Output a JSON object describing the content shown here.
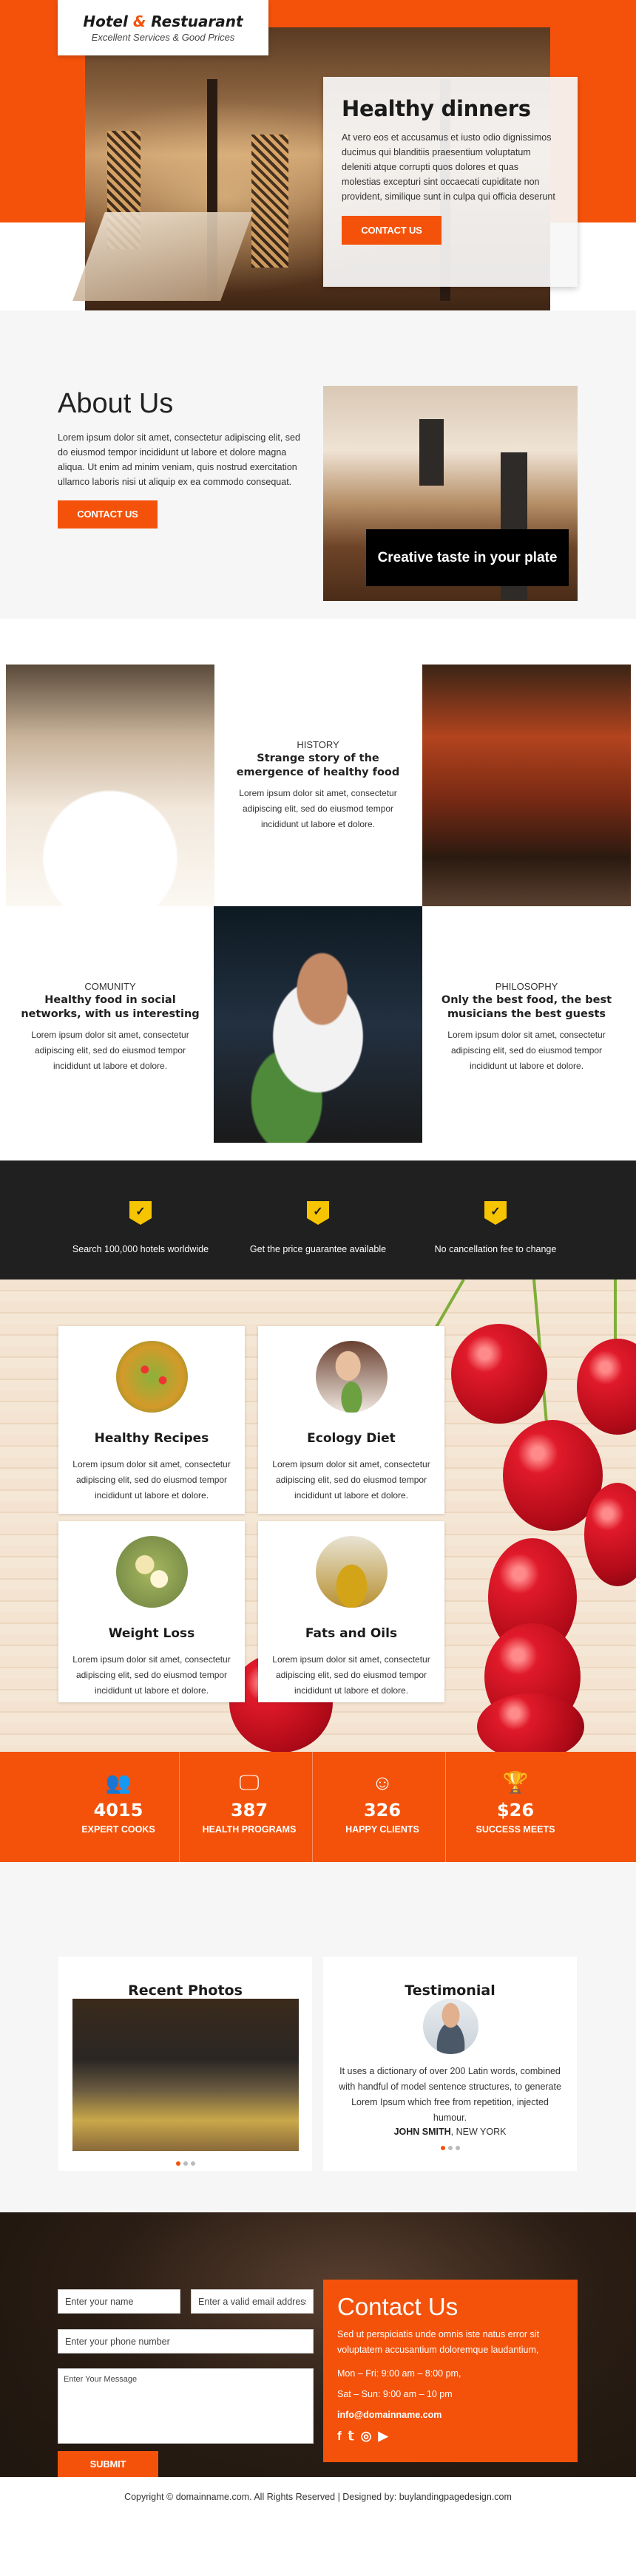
{
  "brand": {
    "name_part1": "Hotel",
    "name_amp": "&",
    "name_part2": "Restuarant",
    "tagline": "Excellent Services & Good Prices",
    "accent_color": "#f4520b"
  },
  "hero": {
    "title": "Healthy dinners",
    "body": "At vero eos et accusamus et iusto odio dignissimos ducimus qui blanditiis praesentium voluptatum deleniti atque corrupti quos dolores et quas molestias excepturi sint occaecati cupiditate non provident, similique sunt in culpa qui officia deserunt",
    "cta": "CONTACT US"
  },
  "about": {
    "title": "About Us",
    "body": "Lorem ipsum dolor sit amet, consectetur adipiscing elit, sed do eiusmod tempor incididunt ut labore et dolore magna aliqua. Ut enim ad minim veniam, quis nostrud exercitation ullamco laboris nisi ut aliquip ex ea commodo consequat.",
    "cta": "CONTACT US",
    "image_caption": "Creative taste in your plate"
  },
  "story_grid": [
    {
      "category": "HISTORY",
      "title": "Strange story of the emergence of healthy food",
      "body": "Lorem ipsum dolor sit amet, consectetur adipiscing elit, sed do eiusmod tempor incididunt ut labore et dolore."
    },
    {
      "category": "COMUNITY",
      "title": "Healthy food in social networks, with us interesting",
      "body": "Lorem ipsum dolor sit amet, consectetur adipiscing elit, sed do eiusmod tempor incididunt ut labore et dolore."
    },
    {
      "category": "PHILOSOPHY",
      "title": "Only the best food, the best musicians the best guests",
      "body": "Lorem ipsum dolor sit amet, consectetur adipiscing elit, sed do eiusmod tempor incididunt ut labore et dolore."
    }
  ],
  "trust": [
    {
      "icon": "shield-check-icon",
      "label": "Search 100,000 hotels worldwide"
    },
    {
      "icon": "shield-check-icon",
      "label": "Get the price guarantee available"
    },
    {
      "icon": "shield-check-icon",
      "label": "No cancellation fee to change"
    }
  ],
  "services": [
    {
      "title": "Healthy Recipes",
      "body": "Lorem ipsum dolor sit amet, consectetur adipiscing elit, sed do eiusmod tempor incididunt ut labore et dolore."
    },
    {
      "title": "Ecology Diet",
      "body": "Lorem ipsum dolor sit amet, consectetur adipiscing elit, sed do eiusmod tempor incididunt ut labore et dolore."
    },
    {
      "title": "Weight Loss",
      "body": "Lorem ipsum dolor sit amet, consectetur adipiscing elit, sed do eiusmod tempor incididunt ut labore et dolore."
    },
    {
      "title": "Fats and Oils",
      "body": "Lorem ipsum dolor sit amet, consectetur adipiscing elit, sed do eiusmod tempor incididunt ut labore et dolore."
    }
  ],
  "stats": [
    {
      "icon": "users-icon",
      "value": "4015",
      "label": "EXPERT COOKS"
    },
    {
      "icon": "monitor-icon",
      "value": "387",
      "label": "HEALTH PROGRAMS"
    },
    {
      "icon": "smiley-icon",
      "value": "326",
      "label": "HAPPY CLIENTS"
    },
    {
      "icon": "trophy-icon",
      "value": "$26",
      "label": "SUCCESS MEETS"
    }
  ],
  "gallery": {
    "photos_title": "Recent Photos",
    "testimonial_title": "Testimonial",
    "quote": "It uses a dictionary of over 200 Latin words, combined with handful of model sentence structures, to generate Lorem Ipsum which free from repetition, injected humour.",
    "author_name": "JOHN SMITH",
    "author_location": ", NEW YORK",
    "photos_active_dot": 1,
    "testimonial_active_dot": 1,
    "dot_count": 3
  },
  "contact_form": {
    "name_placeholder": "Enter your name",
    "email_placeholder": "Enter a valid email address",
    "phone_placeholder": "Enter your phone number",
    "message_placeholder": "Enter Your Message",
    "submit": "SUBMIT"
  },
  "contact_info": {
    "title": "Contact Us",
    "body": "Sed ut perspiciatis unde omnis iste natus error sit voluptatem accusantium doloremque laudantium,",
    "weekday_hours": "Mon – Fri: 9:00 am – 8:00 pm,",
    "weekend_hours": "Sat – Sun: 9:00 am – 10 pm",
    "email": "info@domainname.com",
    "social": [
      {
        "icon": "facebook-icon",
        "glyph": "f"
      },
      {
        "icon": "twitter-icon",
        "glyph": "🐦"
      },
      {
        "icon": "instagram-icon",
        "glyph": "◎"
      },
      {
        "icon": "youtube-icon",
        "glyph": "▶"
      }
    ]
  },
  "footer": {
    "text": "Copyright © domainname.com. All Rights Reserved | Designed by: buylandingpagedesign.com"
  }
}
